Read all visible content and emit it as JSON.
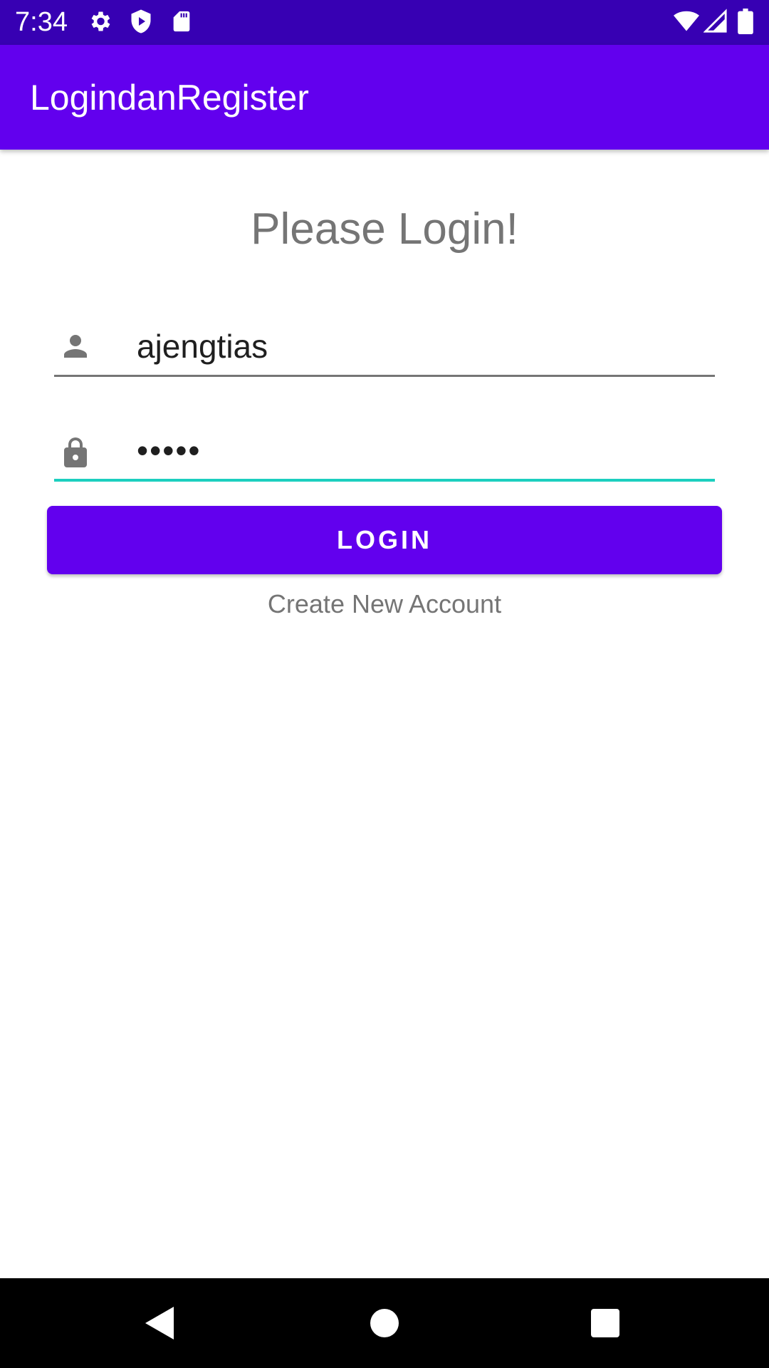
{
  "status_bar": {
    "time": "7:34",
    "icons_left": [
      "gear-icon",
      "shield-play-icon",
      "sd-card-icon"
    ],
    "icons_right": [
      "wifi-icon",
      "cell-signal-icon",
      "battery-icon"
    ],
    "background": "#3700b3"
  },
  "app_bar": {
    "title": "LogindanRegister",
    "background": "#6200ee"
  },
  "login_form": {
    "heading": "Please Login!",
    "username_value": "ajengtias",
    "username_icon": "person-icon",
    "password_value": "•••••",
    "password_icon": "lock-icon",
    "focused_underline_color": "#1ccfbf",
    "login_label": "LOGIN",
    "create_account_label": "Create New Account"
  },
  "nav_bar": {
    "buttons": [
      "back-icon",
      "home-icon",
      "recents-icon"
    ]
  }
}
